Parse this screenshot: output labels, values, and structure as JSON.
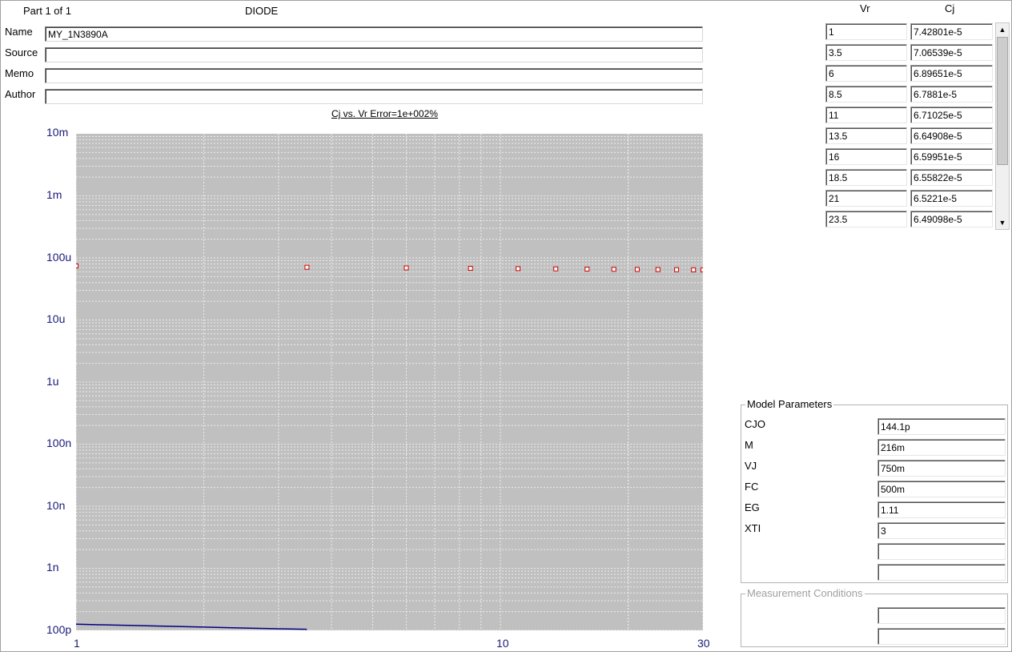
{
  "header": {
    "part_label": "Part 1 of 1",
    "device_type": "DIODE"
  },
  "form": {
    "name_label": "Name",
    "name_value": "MY_1N3890A",
    "source_label": "Source",
    "source_value": "",
    "memo_label": "Memo",
    "memo_value": "",
    "author_label": "Author",
    "author_value": ""
  },
  "table": {
    "col_vr": "Vr",
    "col_cj": "Cj",
    "rows": [
      {
        "vr": "1",
        "cj": "7.42801e-5"
      },
      {
        "vr": "3.5",
        "cj": "7.06539e-5"
      },
      {
        "vr": "6",
        "cj": "6.89651e-5"
      },
      {
        "vr": "8.5",
        "cj": "6.7881e-5"
      },
      {
        "vr": "11",
        "cj": "6.71025e-5"
      },
      {
        "vr": "13.5",
        "cj": "6.64908e-5"
      },
      {
        "vr": "16",
        "cj": "6.59951e-5"
      },
      {
        "vr": "18.5",
        "cj": "6.55822e-5"
      },
      {
        "vr": "21",
        "cj": "6.5221e-5"
      },
      {
        "vr": "23.5",
        "cj": "6.49098e-5"
      }
    ]
  },
  "model_parameters": {
    "title": "Model Parameters",
    "params": [
      {
        "name": "CJO",
        "value": "144.1p"
      },
      {
        "name": "M",
        "value": "216m"
      },
      {
        "name": "VJ",
        "value": "750m"
      },
      {
        "name": "FC",
        "value": "500m"
      },
      {
        "name": "EG",
        "value": "1.11"
      },
      {
        "name": "XTI",
        "value": "3"
      },
      {
        "name": "",
        "value": ""
      },
      {
        "name": "",
        "value": ""
      }
    ]
  },
  "measurement_conditions": {
    "title": "Measurement Conditions",
    "fields": [
      "",
      ""
    ]
  },
  "colors": {
    "plot_background": "#c0c0c0",
    "grid": "#ececec",
    "axis_text": "#1a1a7a",
    "measured_marker": "#cc0000",
    "model_curve": "#000080"
  },
  "chart_data": {
    "type": "scatter",
    "title": "Cj vs. Vr Error=1e+002%",
    "x_scale": "log",
    "y_scale": "log",
    "xlim": [
      1,
      30
    ],
    "ylim": [
      1e-10,
      0.01
    ],
    "x_tick_labels": [
      "1",
      "10",
      "30"
    ],
    "y_tick_labels": [
      "10m",
      "1m",
      "100u",
      "10u",
      "1u",
      "100n",
      "10n",
      "1n",
      "100p"
    ],
    "series": [
      {
        "type": "scatter",
        "x": [
          1,
          3.5,
          6,
          8.5,
          11,
          13.5,
          16,
          18.5,
          21,
          23.5,
          26,
          28.5,
          30
        ],
        "y": [
          7.42801e-05,
          7.06539e-05,
          6.89651e-05,
          6.7881e-05,
          6.71025e-05,
          6.64908e-05,
          6.59951e-05,
          6.55822e-05,
          6.5221e-05,
          6.49098e-05,
          6.46e-05,
          6.43e-05,
          6.42e-05
        ]
      },
      {
        "type": "line",
        "x": [
          1,
          1.2,
          1.5,
          2,
          2.5,
          3,
          3.5
        ],
        "y": [
          1.26e-10,
          1.22e-10,
          1.18e-10,
          1.13e-10,
          1.09e-10,
          1.06e-10,
          1.04e-10
        ]
      }
    ]
  }
}
